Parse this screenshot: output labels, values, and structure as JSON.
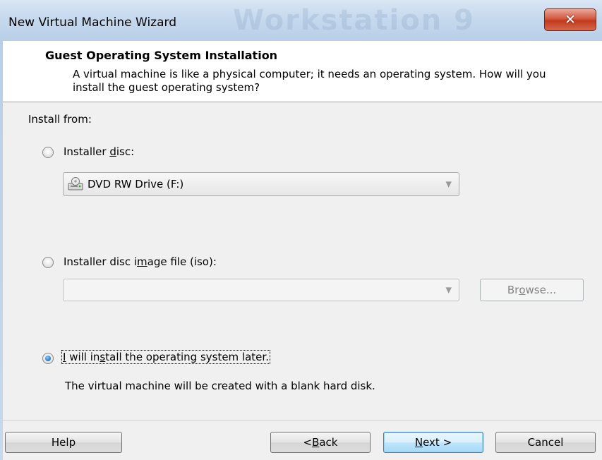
{
  "window": {
    "title": "New Virtual Machine Wizard",
    "watermark": "Workstation 9"
  },
  "header": {
    "title": "Guest Operating System Installation",
    "description": "A virtual machine is like a physical computer; it needs an operating system. How will you install the guest operating system?"
  },
  "install_from": {
    "label": "Install from:",
    "options": [
      {
        "label": "Installer disc:",
        "checked": false
      },
      {
        "label": "Installer disc image file (iso):",
        "checked": false
      },
      {
        "label": "I will install the operating system later.",
        "checked": true
      }
    ],
    "disc_drive": {
      "value": "DVD RW Drive (F:)",
      "icon": "dvd-drive-icon"
    },
    "iso_path": {
      "value": ""
    },
    "browse_label": "Browse...",
    "later_note": "The virtual machine will be created with a blank hard disk."
  },
  "buttons": {
    "help": "Help",
    "back": "< Back",
    "next": "Next >",
    "cancel": "Cancel"
  },
  "colors": {
    "titlebar": "#c6d9ee",
    "close_button": "#c23a1d",
    "default_button_border": "#3c7fb1",
    "window_background": "#f0f0f0"
  }
}
